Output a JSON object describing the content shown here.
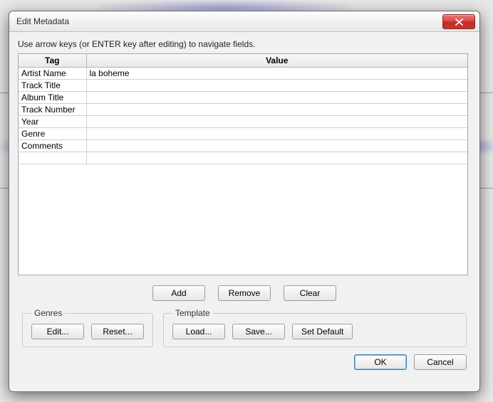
{
  "window": {
    "title": "Edit Metadata"
  },
  "hint": "Use arrow keys (or ENTER key after editing) to navigate fields.",
  "table": {
    "headers": {
      "tag": "Tag",
      "value": "Value"
    },
    "rows": [
      {
        "tag": "Artist Name",
        "value": "la boheme"
      },
      {
        "tag": "Track Title",
        "value": ""
      },
      {
        "tag": "Album Title",
        "value": ""
      },
      {
        "tag": "Track Number",
        "value": ""
      },
      {
        "tag": "Year",
        "value": ""
      },
      {
        "tag": "Genre",
        "value": ""
      },
      {
        "tag": "Comments",
        "value": ""
      },
      {
        "tag": "",
        "value": ""
      }
    ]
  },
  "buttons": {
    "add": "Add",
    "remove": "Remove",
    "clear": "Clear",
    "ok": "OK",
    "cancel": "Cancel"
  },
  "groups": {
    "genres": {
      "legend": "Genres",
      "edit": "Edit...",
      "reset": "Reset..."
    },
    "template": {
      "legend": "Template",
      "load": "Load...",
      "save": "Save...",
      "set_default": "Set Default"
    }
  }
}
